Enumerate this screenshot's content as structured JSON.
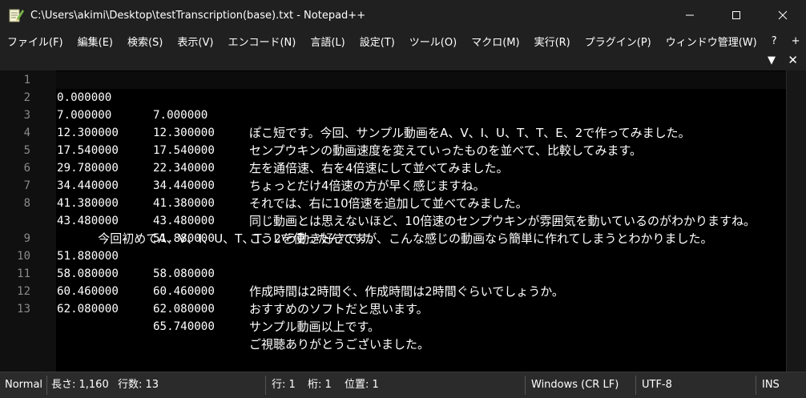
{
  "window": {
    "title": "C:\\Users\\akimi\\Desktop\\testTranscription(base).txt - Notepad++",
    "app_icon": "notepadpp-icon",
    "controls": {
      "minimize": "─",
      "maximize": "☐",
      "close": "✕"
    }
  },
  "menu": {
    "items": [
      "ファイル(F)",
      "編集(E)",
      "検索(S)",
      "表示(V)",
      "エンコード(N)",
      "言語(L)",
      "設定(T)",
      "ツール(O)",
      "マクロ(M)",
      "実行(R)",
      "プラグイン(P)",
      "ウィンドウ管理(W)",
      "?",
      "+"
    ]
  },
  "toolbar": {
    "dropdown": "▼",
    "close": "✕"
  },
  "editor": {
    "line_numbers": [
      "1",
      "2",
      "3",
      "4",
      "5",
      "6",
      "7",
      "8",
      "9",
      "10",
      "11",
      "12",
      "13"
    ],
    "lines": [
      {
        "start": "0.000000",
        "end": "7.000000",
        "text": "ぽこ短です。今回、サンプル動画をA、V、I、U、T、T、E、2で作ってみました。"
      },
      {
        "start": "7.000000",
        "end": "12.300000",
        "text": "センプウキンの動画速度を変えていったものを並べて、比較してみます。"
      },
      {
        "start": "12.300000",
        "end": "17.540000",
        "text": "左を通倍速、右を4倍速にして並べてみました。"
      },
      {
        "start": "17.540000",
        "end": "22.340000",
        "text": "ちょっとだけ4倍速の方が早く感じますね。"
      },
      {
        "start": "29.780000",
        "end": "34.440000",
        "text": "それでは、右に10倍速を追加して並べてみました。"
      },
      {
        "start": "34.440000",
        "end": "41.380000",
        "text": "同じ動画とは思えないほど、10倍速のセンプウキンが雰囲気を動いているのがわかりますね。"
      },
      {
        "start": "41.380000",
        "end": "43.480000",
        "text": "こういう動き好きです。"
      },
      {
        "start": "43.480000",
        "end": "51.880000",
        "text": ""
      },
      {
        "wrap": "今回初めてA、V、I、U、T、T、2を使ったんですが、こんな感じの動画なら簡単に作れてしまうとわかりました。"
      },
      {
        "start": "51.880000",
        "end": "58.080000",
        "text": "作成時間は2時間ぐ、作成時間は2時間ぐらいでしょうか。"
      },
      {
        "start": "58.080000",
        "end": "60.460000",
        "text": "おすすめのソフトだと思います。"
      },
      {
        "start": "60.460000",
        "end": "62.080000",
        "text": "サンプル動画以上です。"
      },
      {
        "start": "62.080000",
        "end": "65.740000",
        "text": "ご視聴ありがとうございました。"
      }
    ]
  },
  "status": {
    "mode": "Normal",
    "length": "長さ: 1,160",
    "lines": "行数: 13",
    "line": "行: 1",
    "column": "桁: 1",
    "position": "位置: 1",
    "eol": "Windows (CR LF)",
    "encoding": "UTF-8",
    "insert": "INS"
  }
}
